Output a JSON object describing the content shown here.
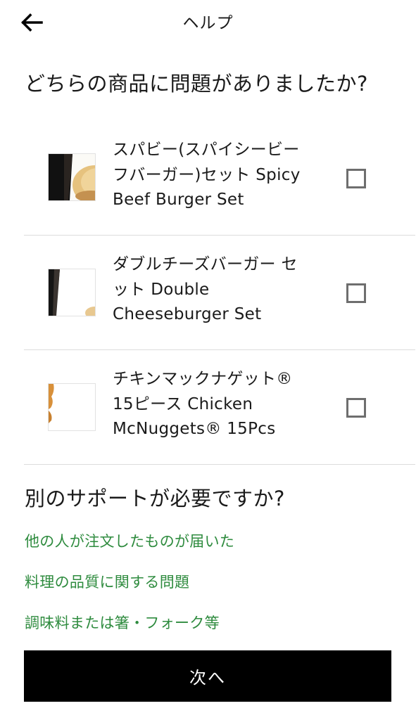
{
  "header": {
    "title": "ヘルプ",
    "back_icon": "arrow-left-icon"
  },
  "question": "どちらの商品に問題がありましたか?",
  "items": [
    {
      "name_lines": [
        "スパビー(スパイシービー",
        "フバーガー)セット Spicy",
        "Beef Burger Set"
      ],
      "checked": false
    },
    {
      "name_lines": [
        "ダブルチーズバーガー セ",
        "ット Double",
        "Cheeseburger Set"
      ],
      "checked": false
    },
    {
      "name_lines": [
        "チキンマックナゲット®",
        "15ピース Chicken",
        "McNuggets® 15Pcs"
      ],
      "checked": false
    }
  ],
  "support": {
    "title": "別のサポートが必要ですか?",
    "links": [
      "他の人が注文したものが届いた",
      "料理の品質に関する問題",
      "調味料または箸・フォーク等"
    ]
  },
  "next_button": "次へ",
  "colors": {
    "link_green": "#2e8b3e",
    "button_black": "#000000",
    "divider": "#dcdcdc",
    "checkbox_border": "#6e6e6e"
  }
}
